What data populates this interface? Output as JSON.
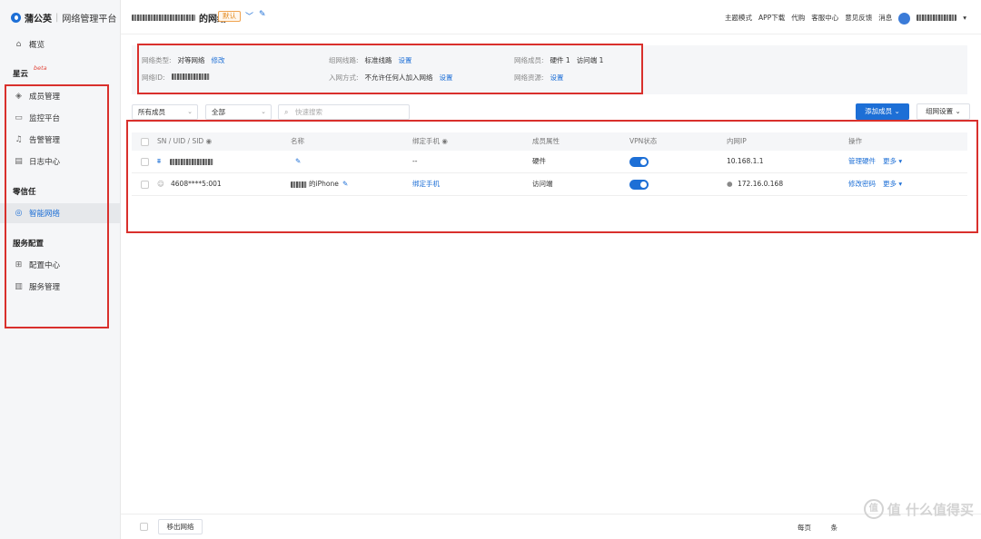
{
  "brand": {
    "name": "蒲公英",
    "subtitle": "网络管理平台"
  },
  "sidebar": {
    "overview": "概览",
    "group_xingyun": "星云",
    "beta": "beta",
    "items_xingyun": [
      "成员管理",
      "监控平台",
      "告警管理",
      "日志中心"
    ],
    "group_zero": "零信任",
    "smart_net": "智能网络",
    "group_service": "服务配置",
    "items_service": [
      "配置中心",
      "服务管理"
    ]
  },
  "topbar": {
    "net_suffix": "的网络",
    "default_tag": "默认",
    "links": [
      "主题模式",
      "APP下载",
      "代购",
      "客服中心",
      "意见反馈",
      "消息"
    ]
  },
  "info": {
    "net_type_label": "网络类型:",
    "net_type_value": "对等网络",
    "modify": "修改",
    "net_id_label": "网络ID:",
    "line_label": "组网线路:",
    "line_value": "标准线路",
    "line_set": "设置",
    "join_label": "入网方式:",
    "join_value": "不允许任何人加入网络",
    "join_set": "设置",
    "members_label": "网络成员:",
    "members_hw": "硬件 1",
    "members_visitor": "访问端 1",
    "resource_label": "网络资源:",
    "resource_set": "设置"
  },
  "filters": {
    "member": "所有成员",
    "all": "全部",
    "search_placeholder": "快速搜索"
  },
  "actions": {
    "add_member": "添加成员",
    "group_settings": "组网设置"
  },
  "table": {
    "headers": [
      "SN / UID / SID",
      "名称",
      "绑定手机",
      "成员属性",
      "VPN状态",
      "内网IP",
      "操作"
    ],
    "rows": [
      {
        "name": "",
        "phone": "--",
        "attr": "硬件",
        "vpn": true,
        "ip": "10.168.1.1",
        "op": "管理硬件",
        "more": "更多"
      },
      {
        "id": "4608****5:001",
        "name": "的iPhone",
        "phone": "绑定手机",
        "attr": "访问端",
        "vpn": true,
        "ip": "172.16.0.168",
        "op": "修改密码",
        "more": "更多"
      }
    ]
  },
  "footer": {
    "remove": "移出网络",
    "per_page": "每页",
    "unit": "条"
  },
  "watermark": "值 什么值得买",
  "colors": {
    "accent": "#1d6fd6",
    "highlight": "#d9302c"
  }
}
